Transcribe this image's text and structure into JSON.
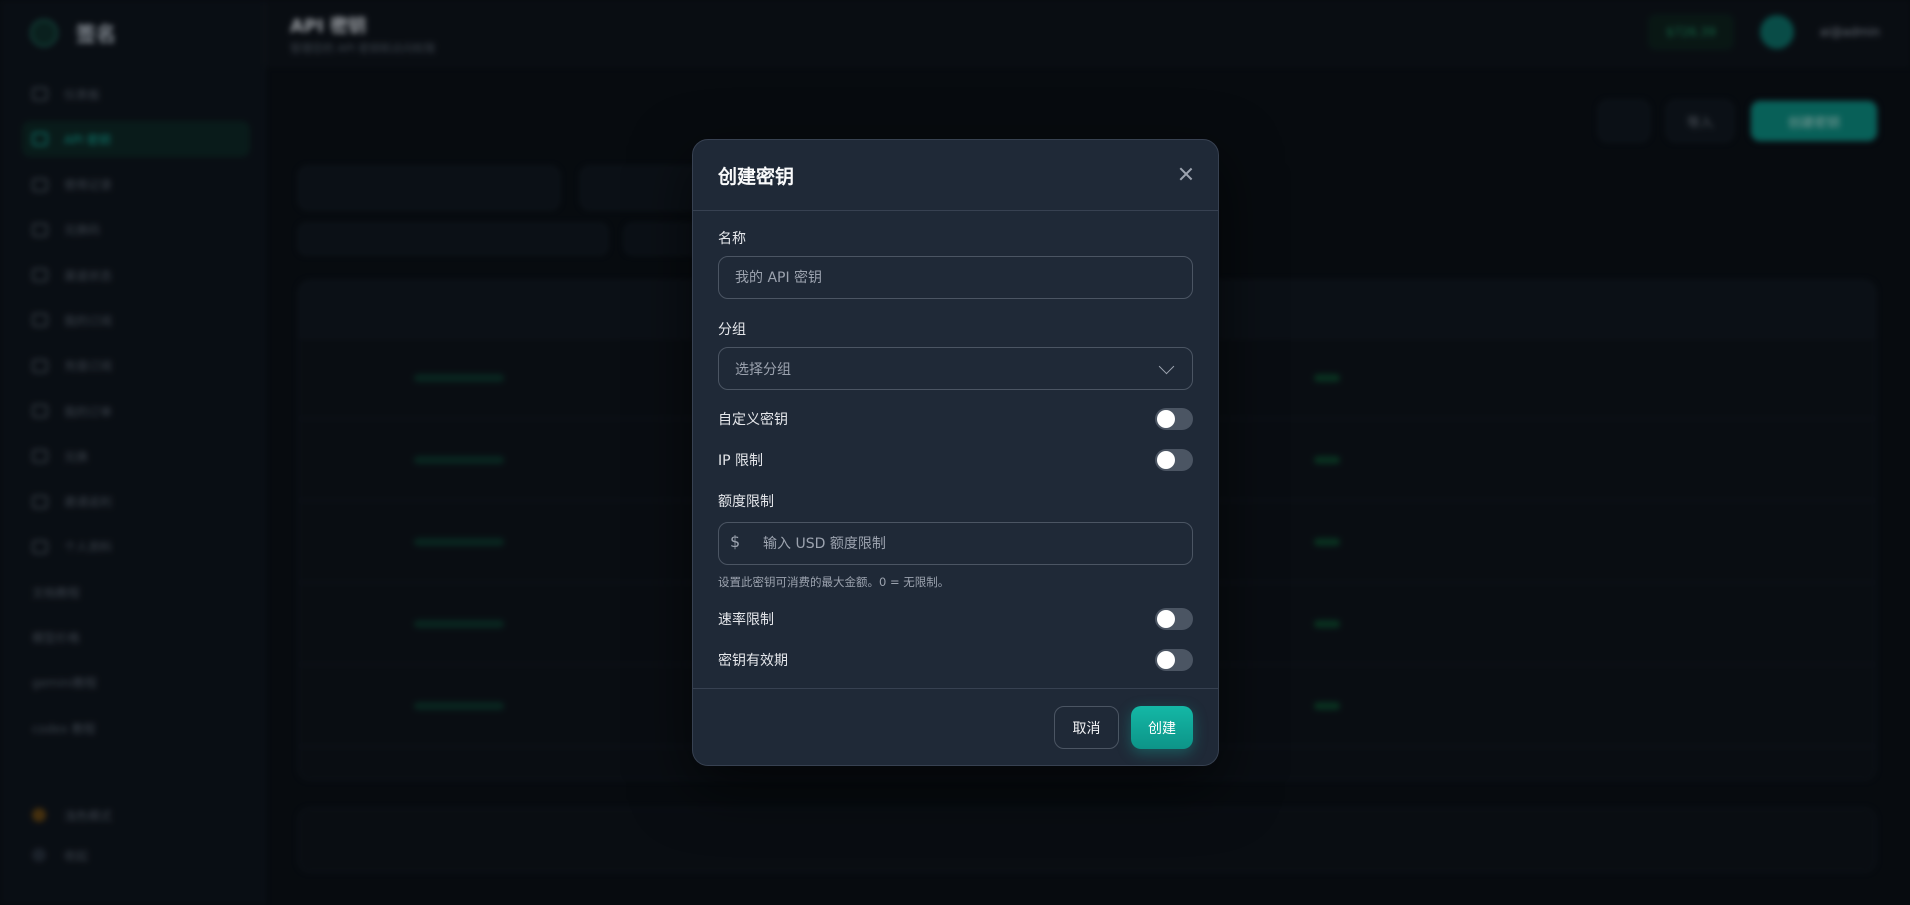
{
  "app": {
    "brand": "签名",
    "page_title": "API 密钥",
    "page_subtitle": "管理您的 API 密钥和访问权限"
  },
  "sidebar": {
    "items": [
      {
        "label": "仪表板",
        "icon": "dashboard-icon"
      },
      {
        "label": "API 密钥",
        "icon": "key-icon",
        "active": true
      },
      {
        "label": "使用记录",
        "icon": "chart-icon"
      },
      {
        "label": "兑换码",
        "icon": "code-icon"
      },
      {
        "label": "渠道状态",
        "icon": "status-icon"
      },
      {
        "label": "我的订阅",
        "icon": "subscription-icon"
      },
      {
        "label": "充值订阅",
        "icon": "plus-icon"
      },
      {
        "label": "我的订单",
        "icon": "order-icon"
      },
      {
        "label": "兑换",
        "icon": "gift-icon"
      },
      {
        "label": "邀请返利",
        "icon": "invite-icon"
      },
      {
        "label": "个人资料",
        "icon": "user-icon"
      }
    ],
    "links": [
      "文档教程",
      "模型价格",
      "gemini教程",
      "codex 教程"
    ],
    "bottom": [
      "浅色模式",
      "收起"
    ]
  },
  "topbar": {
    "balance": "$726.39",
    "user_name": "ai@admin"
  },
  "actions": {
    "refresh": "",
    "import": "导入",
    "create": "创建密钥"
  },
  "modal": {
    "title": "创建密钥",
    "name_label": "名称",
    "name_placeholder": "我的 API 密钥",
    "group_label": "分组",
    "group_placeholder": "选择分组",
    "custom_key_label": "自定义密钥",
    "ip_limit_label": "IP 限制",
    "quota_label": "额度限制",
    "quota_prefix": "$",
    "quota_placeholder": "输入 USD 额度限制",
    "quota_hint": "设置此密钥可消费的最大金额。0 = 无限制。",
    "rate_limit_label": "速率限制",
    "expiry_label": "密钥有效期",
    "cancel": "取消",
    "create": "创建",
    "toggles": {
      "custom_key": false,
      "ip_limit": false,
      "rate_limit": false,
      "expiry": false
    }
  },
  "colors": {
    "accent": "#14b8a6",
    "modal_bg": "#1f2937",
    "page_bg": "#0b1118"
  }
}
